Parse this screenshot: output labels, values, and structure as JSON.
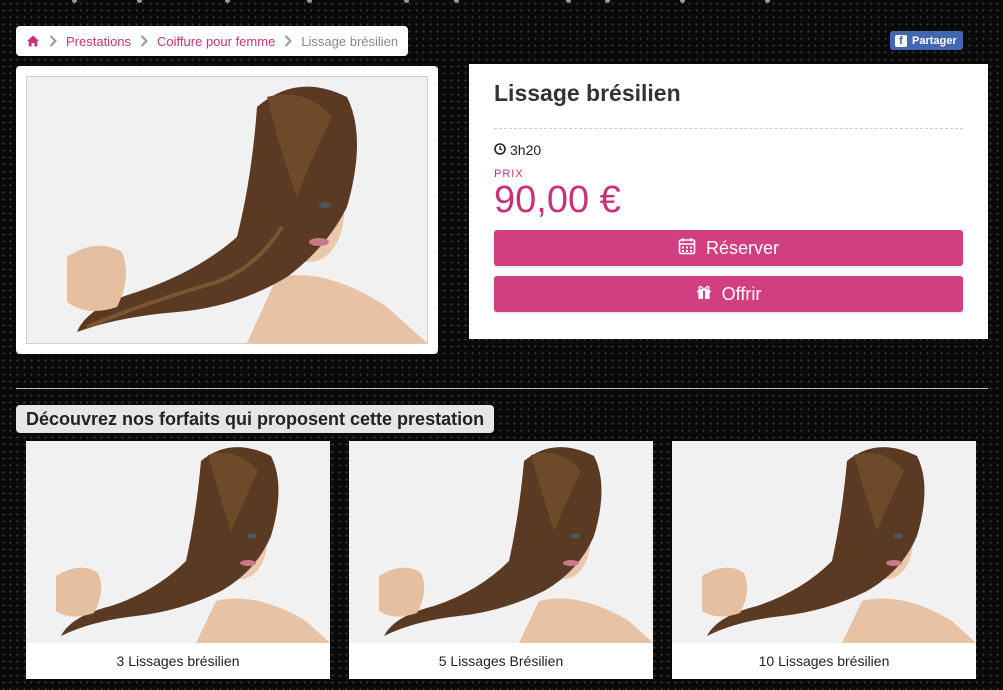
{
  "breadcrumb": {
    "items": [
      {
        "label": "Prestations"
      },
      {
        "label": "Coiffure pour femme"
      }
    ],
    "current": "Lissage brésilien"
  },
  "share": {
    "label": "Partager"
  },
  "service": {
    "title": "Lissage brésilien",
    "duration": "3h20",
    "price_label": "PRIX",
    "price": "90,00 €",
    "reserve_label": "Réserver",
    "offer_label": "Offrir"
  },
  "packages": {
    "title": "Découvrez nos forfaits qui proposent cette prestation",
    "items": [
      {
        "name": "3 Lissages brésilien"
      },
      {
        "name": "5 Lissages Brésilien"
      },
      {
        "name": "10 Lissages brésilien"
      }
    ]
  },
  "colors": {
    "accent": "#d23f80",
    "link": "#c8327a",
    "facebook": "#4267b2"
  },
  "icons": [
    "home-icon",
    "chevron-right-icon",
    "facebook-icon",
    "clock-icon",
    "calendar-icon",
    "gift-icon"
  ]
}
